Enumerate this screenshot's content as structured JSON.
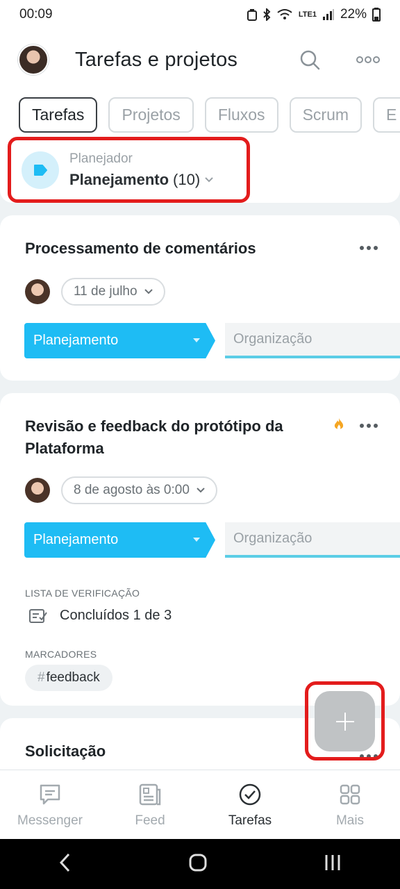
{
  "status": {
    "time": "00:09",
    "battery": "22%",
    "network": "LTE1"
  },
  "header": {
    "title": "Tarefas e projetos",
    "avatar_icon": "user-avatar",
    "search_icon": "search-icon",
    "more_icon": "more-horizontal-icon"
  },
  "tabs": [
    {
      "label": "Tarefas",
      "active": true
    },
    {
      "label": "Projetos"
    },
    {
      "label": "Fluxos"
    },
    {
      "label": "Scrum"
    },
    {
      "label": "E"
    }
  ],
  "planner": {
    "label": "Planejador",
    "value": "Planejamento",
    "count": "(10)",
    "accent": "#1ebcf4"
  },
  "cards": [
    {
      "title": "Processamento de comentários",
      "date": "11 de julho",
      "stage": "Planejamento",
      "next_stage": "Organização"
    },
    {
      "title_line1": "Revisão e feedback do protótipo da",
      "title_line2": "Plataforma",
      "date": "8 de agosto às 0:00",
      "stage": "Planejamento",
      "next_stage": "Organização",
      "checklist_label": "LISTA DE VERIFICAÇÃO",
      "checklist_value": "Concluídos 1 de 3",
      "tags_label": "MARCADORES",
      "tag": "feedback",
      "tag_hash": "#"
    },
    {
      "title": "Solicitação"
    }
  ],
  "fab": {
    "icon": "plus-icon"
  },
  "bottom_nav": [
    {
      "label": "Messenger",
      "icon": "chat-icon"
    },
    {
      "label": "Feed",
      "icon": "feed-icon"
    },
    {
      "label": "Tarefas",
      "icon": "check-circle-icon",
      "active": true
    },
    {
      "label": "Mais",
      "icon": "grid-icon"
    }
  ],
  "colors": {
    "accent": "#1ebcf4",
    "highlight": "#e31c1c"
  }
}
